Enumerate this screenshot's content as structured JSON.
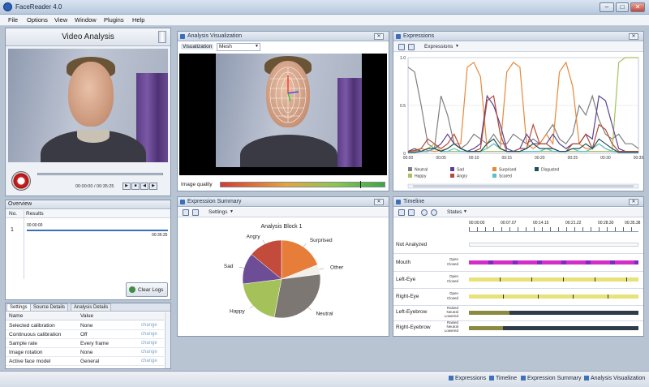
{
  "window": {
    "title": "FaceReader 4.0"
  },
  "menu": [
    "File",
    "Options",
    "View",
    "Window",
    "Plugins",
    "Help"
  ],
  "video_analysis": {
    "title": "Video Analysis",
    "time_current": "00:00:00",
    "time_total": "/ 00:35:25"
  },
  "overview": {
    "title": "Overview",
    "col_no": "No.",
    "col_results": "Results",
    "row_no": "1",
    "row_start": "00:00:00",
    "row_end": "00:35:35",
    "clear_logs": "Clear Logs"
  },
  "settings": {
    "tabs": [
      "Settings",
      "Source Details",
      "Analysis Details"
    ],
    "col_name": "Name",
    "col_value": "Value",
    "change_label": "change",
    "rows": [
      {
        "name": "Selected calibration",
        "value": "None"
      },
      {
        "name": "Continuous calibration",
        "value": "Off"
      },
      {
        "name": "Sample rate",
        "value": "Every frame"
      },
      {
        "name": "Image rotation",
        "value": "None"
      },
      {
        "name": "Active face model",
        "value": "General"
      }
    ]
  },
  "analysis_visualization": {
    "title": "Analysis Visualization",
    "viz_label": "Visualization",
    "viz_value": "Mesh",
    "image_quality_label": "Image quality",
    "image_quality": 0.85
  },
  "expressions_panel": {
    "title": "Expressions",
    "dropdown": "Expressions",
    "y_ticks": [
      "1.0",
      "0.5",
      "0"
    ],
    "x_ticks": [
      "00:00",
      "00:05",
      "00:10",
      "00:15",
      "00:20",
      "00:25",
      "00:30",
      "00:35"
    ],
    "legend": [
      {
        "name": "Neutral",
        "color": "#7f7f7f"
      },
      {
        "name": "Sad",
        "color": "#5b3f8f"
      },
      {
        "name": "Surprised",
        "color": "#e8883a"
      },
      {
        "name": "Disgusted",
        "color": "#1f4f5a"
      },
      {
        "name": "Happy",
        "color": "#a6c25c"
      },
      {
        "name": "Angry",
        "color": "#b24b3a"
      },
      {
        "name": "Scared",
        "color": "#58c1c9"
      }
    ]
  },
  "chart_data": {
    "type": "line",
    "x": [
      0,
      1,
      2,
      3,
      4,
      5,
      6,
      7,
      8,
      9,
      10,
      11,
      12,
      13,
      14,
      15,
      16,
      17,
      18,
      19,
      20,
      21,
      22,
      23,
      24,
      25,
      26,
      27,
      28,
      29,
      30,
      31,
      32,
      33,
      34,
      35
    ],
    "ylim": [
      0,
      1
    ],
    "xlabel": "",
    "ylabel": "",
    "series": [
      {
        "name": "Neutral",
        "color": "#7f7f7f",
        "values": [
          0.9,
          0.85,
          0.5,
          0.1,
          0.05,
          0.6,
          0.4,
          0.1,
          0.05,
          0.1,
          0.2,
          0.15,
          0.1,
          0.2,
          0.1,
          0.1,
          0.2,
          0.15,
          0.1,
          0.15,
          0.1,
          0.2,
          0.3,
          0.15,
          0.1,
          0.2,
          0.5,
          0.4,
          0.6,
          0.35,
          0.2,
          0.15,
          0.2,
          0.1,
          0.1,
          0.05
        ]
      },
      {
        "name": "Surprised",
        "color": "#e8883a",
        "values": [
          0.02,
          0.02,
          0.05,
          0.03,
          0.02,
          0.03,
          0.05,
          0.1,
          0.1,
          0.9,
          0.95,
          0.8,
          0.05,
          0.1,
          0.05,
          0.85,
          0.95,
          0.9,
          0.1,
          0.05,
          0.1,
          0.2,
          0.1,
          0.85,
          0.95,
          0.7,
          0.1,
          0.05,
          0.05,
          0.1,
          0.05,
          0.02,
          0.02,
          0.02,
          0.02,
          0.02
        ]
      },
      {
        "name": "Happy",
        "color": "#a6c25c",
        "values": [
          0.02,
          0.02,
          0.02,
          0.05,
          0.1,
          0.02,
          0.02,
          0.02,
          0.02,
          0.02,
          0.02,
          0.02,
          0.02,
          0.02,
          0.02,
          0.02,
          0.02,
          0.02,
          0.02,
          0.02,
          0.02,
          0.02,
          0.02,
          0.02,
          0.02,
          0.02,
          0.02,
          0.02,
          0.02,
          0.02,
          0.02,
          0.02,
          0.95,
          1.0,
          1.0,
          1.0
        ]
      },
      {
        "name": "Sad",
        "color": "#5b3f8f",
        "values": [
          0.02,
          0.05,
          0.02,
          0.02,
          0.05,
          0.1,
          0.2,
          0.1,
          0.05,
          0.02,
          0.05,
          0.1,
          0.6,
          0.5,
          0.3,
          0.05,
          0.02,
          0.05,
          0.2,
          0.1,
          0.1,
          0.1,
          0.2,
          0.1,
          0.05,
          0.1,
          0.1,
          0.2,
          0.15,
          0.6,
          0.55,
          0.3,
          0.05,
          0.02,
          0.02,
          0.02
        ]
      },
      {
        "name": "Angry",
        "color": "#b24b3a",
        "values": [
          0.02,
          0.03,
          0.05,
          0.15,
          0.1,
          0.05,
          0.1,
          0.2,
          0.05,
          0.02,
          0.02,
          0.05,
          0.55,
          0.6,
          0.2,
          0.02,
          0.02,
          0.05,
          0.05,
          0.3,
          0.1,
          0.1,
          0.05,
          0.02,
          0.02,
          0.1,
          0.1,
          0.2,
          0.05,
          0.3,
          0.25,
          0.1,
          0.02,
          0.02,
          0.02,
          0.02
        ]
      },
      {
        "name": "Scared",
        "color": "#58c1c9",
        "values": [
          0.01,
          0.01,
          0.02,
          0.02,
          0.05,
          0.02,
          0.02,
          0.05,
          0.02,
          0.02,
          0.02,
          0.02,
          0.05,
          0.1,
          0.05,
          0.02,
          0.02,
          0.02,
          0.02,
          0.02,
          0.02,
          0.05,
          0.02,
          0.02,
          0.02,
          0.05,
          0.02,
          0.02,
          0.05,
          0.1,
          0.05,
          0.02,
          0.01,
          0.01,
          0.01,
          0.01
        ]
      },
      {
        "name": "Disgusted",
        "color": "#1f4f5a",
        "values": [
          0.01,
          0.01,
          0.02,
          0.05,
          0.05,
          0.02,
          0.05,
          0.1,
          0.05,
          0.02,
          0.02,
          0.02,
          0.1,
          0.15,
          0.05,
          0.02,
          0.02,
          0.02,
          0.05,
          0.1,
          0.05,
          0.05,
          0.05,
          0.02,
          0.02,
          0.05,
          0.05,
          0.1,
          0.05,
          0.15,
          0.1,
          0.05,
          0.01,
          0.01,
          0.01,
          0.01
        ]
      }
    ]
  },
  "expression_summary": {
    "title": "Expression Summary",
    "settings_label": "Settings",
    "pie": {
      "title": "Analysis Block 1",
      "slices": [
        {
          "name": "Surprised",
          "value": 19,
          "color": "#e67e3a"
        },
        {
          "name": "Other",
          "value": 4,
          "color": "#f3f0ea"
        },
        {
          "name": "Neutral",
          "value": 30,
          "color": "#7c7773"
        },
        {
          "name": "Happy",
          "value": 20,
          "color": "#a4c15a"
        },
        {
          "name": "Sad",
          "value": 13,
          "color": "#6d4d96"
        },
        {
          "name": "Angry",
          "value": 14,
          "color": "#c24b3c"
        }
      ]
    }
  },
  "timeline": {
    "title": "Timeline",
    "dropdown": "States",
    "ticks": [
      "00:00:00",
      "00:07.07",
      "00:14.15",
      "00:21.22",
      "00:28.30",
      "00:35.38"
    ],
    "rows": [
      {
        "label": "Not Analyzed",
        "subs": []
      },
      {
        "label": "Mouth",
        "subs": [
          "Open",
          "Closed"
        ]
      },
      {
        "label": "Left-Eye",
        "subs": [
          "Open",
          "Closed"
        ]
      },
      {
        "label": "Right-Eye",
        "subs": [
          "Open",
          "Closed"
        ]
      },
      {
        "label": "Left-Eyebrow",
        "subs": [
          "Raised",
          "Neutral",
          "Lowered"
        ]
      },
      {
        "label": "Right-Eyebrow",
        "subs": [
          "Raised",
          "Neutral",
          "Lowered"
        ]
      }
    ]
  },
  "statusbar": [
    "Expressions",
    "Timeline",
    "Expression Summary",
    "Analysis Visualization"
  ]
}
